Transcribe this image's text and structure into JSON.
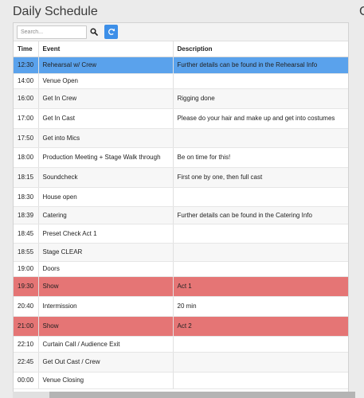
{
  "page": {
    "title": "Daily Schedule",
    "right_title": "C"
  },
  "search": {
    "placeholder": "Search..."
  },
  "table": {
    "headers": [
      "Time",
      "Event",
      "Description"
    ],
    "rows": [
      {
        "time": "12:30",
        "event": "Rehearsal w/ Crew",
        "description": "Further details can be found in the Rehearsal Info",
        "highlight": "blue"
      },
      {
        "time": "14:00",
        "event": "Venue Open",
        "description": ""
      },
      {
        "time": "16:00",
        "event": "Get In Crew",
        "description": "Rigging done"
      },
      {
        "time": "17:00",
        "event": "Get In Cast",
        "description": "Please do your hair and make up and get into costumes"
      },
      {
        "time": "17:50",
        "event": "Get into Mics",
        "description": ""
      },
      {
        "time": "18:00",
        "event": "Production Meeting + Stage Walk through",
        "description": "Be on time for this!"
      },
      {
        "time": "18:15",
        "event": "Soundcheck",
        "description": "First one by one, then full cast"
      },
      {
        "time": "18:30",
        "event": "House open",
        "description": ""
      },
      {
        "time": "18:39",
        "event": "Catering",
        "description": "Further details can be found in the Catering Info"
      },
      {
        "time": "18:45",
        "event": "Preset Check Act 1",
        "description": ""
      },
      {
        "time": "18:55",
        "event": "Stage CLEAR",
        "description": ""
      },
      {
        "time": "19:00",
        "event": "Doors",
        "description": ""
      },
      {
        "time": "19:30",
        "event": "Show",
        "description": "Act 1",
        "highlight": "red"
      },
      {
        "time": "20:40",
        "event": "Intermission",
        "description": "20 min"
      },
      {
        "time": "21:00",
        "event": "Show",
        "description": "Act 2",
        "highlight": "red"
      },
      {
        "time": "22:10",
        "event": "Curtain Call / Audience Exit",
        "description": ""
      },
      {
        "time": "22:45",
        "event": "Get Out Cast / Crew",
        "description": ""
      },
      {
        "time": "00:00",
        "event": "Venue Closing",
        "description": ""
      }
    ]
  },
  "colors": {
    "highlight_blue": "#5aa2ec",
    "highlight_red": "#e57575",
    "accent_button": "#3d8fe8"
  },
  "icons": {
    "search": "search-icon",
    "refresh": "refresh-icon"
  }
}
